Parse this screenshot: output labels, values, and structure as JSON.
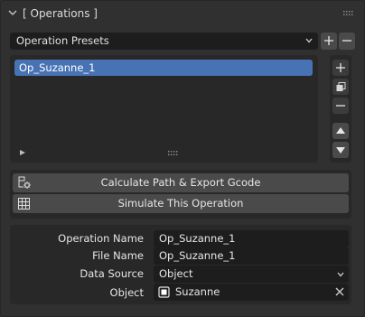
{
  "panel": {
    "title": "[ Operations ]"
  },
  "presets": {
    "label": "Operation Presets"
  },
  "operations_list": {
    "items": [
      {
        "label": "Op_Suzanne_1",
        "selected": true
      }
    ]
  },
  "actions": {
    "calculate_label": "Calculate Path & Export Gcode",
    "simulate_label": "Simulate This Operation"
  },
  "properties": {
    "operation_name": {
      "label": "Operation Name",
      "value": "Op_Suzanne_1"
    },
    "file_name": {
      "label": "File Name",
      "value": "Op_Suzanne_1"
    },
    "data_source": {
      "label": "Data Source",
      "value": "Object"
    },
    "object": {
      "label": "Object",
      "value": "Suzanne"
    }
  },
  "colors": {
    "background": "#303030",
    "field": "#1d1d1d",
    "selected": "#4772b3",
    "button": "#4a4a4a",
    "box": "#282828"
  },
  "icons": [
    "chevron-down-icon",
    "drag-grip-icon",
    "plus-icon",
    "minus-icon",
    "copy-icon",
    "arrow-up-icon",
    "arrow-down-icon",
    "expand-triangle-icon",
    "gcode-export-icon",
    "simulate-grid-icon",
    "object-icon",
    "close-icon"
  ]
}
